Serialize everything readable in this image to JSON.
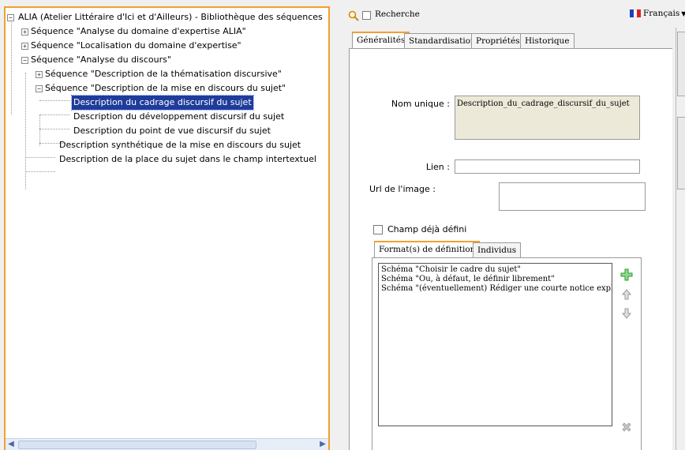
{
  "tree": {
    "root": "ALIA (Atelier Littéraire d'Ici et d'Ailleurs) - Bibliothèque des séquences",
    "items": [
      "Séquence \"Analyse du domaine d'expertise ALIA\"",
      "Séquence \"Localisation du domaine d'expertise\"",
      "Séquence \"Analyse du discours\"",
      "Séquence \"Description de la thématisation discursive\"",
      "Séquence \"Description de la mise en discours du sujet\"",
      "Description du cadrage discursif du sujet",
      "Description du développement discursif du sujet",
      "Description du point de vue discursif du sujet",
      "Description synthétique de la mise en discours du sujet",
      "Description de la place du sujet dans le champ intertextuel"
    ]
  },
  "toolbar": {
    "search_label": "Recherche",
    "language": "Français",
    "flag_colors": [
      "#1f3fbf",
      "#ffffff",
      "#e02020"
    ]
  },
  "tabs": [
    "Généralités",
    "Standardisation",
    "Propriétés",
    "Historique"
  ],
  "form": {
    "unique_name_label": "Nom unique :",
    "unique_name_value": "Description_du_cadrage_discursif_du_sujet",
    "link_label": "Lien :",
    "link_value": "",
    "image_url_label": "Url de l'image :",
    "image_url_value": "",
    "defined_field_label": "Champ déjà défini"
  },
  "inner_tabs": [
    "Format(s) de définition",
    "Individus"
  ],
  "schemas": [
    "Schéma \"Choisir le cadre du sujet\"",
    "Schéma \"Ou, à défaut, le définir librement\"",
    "Schéma \"(éventuellement) Rédiger une courte notice explicative\""
  ],
  "colors": {
    "accent": "#f0a030",
    "selection": "#1f3c9b",
    "readonly_field": "#ece9d8",
    "add_icon": "#3fae3f"
  }
}
